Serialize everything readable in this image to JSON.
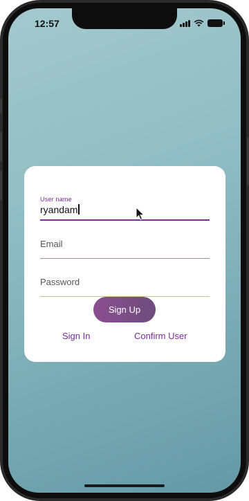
{
  "status_bar": {
    "time": "12:57",
    "icons": [
      "signal-icon",
      "wifi-icon",
      "battery-icon"
    ]
  },
  "form": {
    "username": {
      "label": "User name",
      "value": "ryandam"
    },
    "email": {
      "placeholder": "Email"
    },
    "password": {
      "placeholder": "Password"
    },
    "signup_label": "Sign Up",
    "signin_label": "Sign In",
    "confirm_label": "Confirm User"
  },
  "colors": {
    "accent": "#7b2b9a",
    "button_start": "#8a4e8e",
    "button_end": "#6e4d7e",
    "background_top": "#a3c9ce",
    "background_bottom": "#6499a6"
  }
}
